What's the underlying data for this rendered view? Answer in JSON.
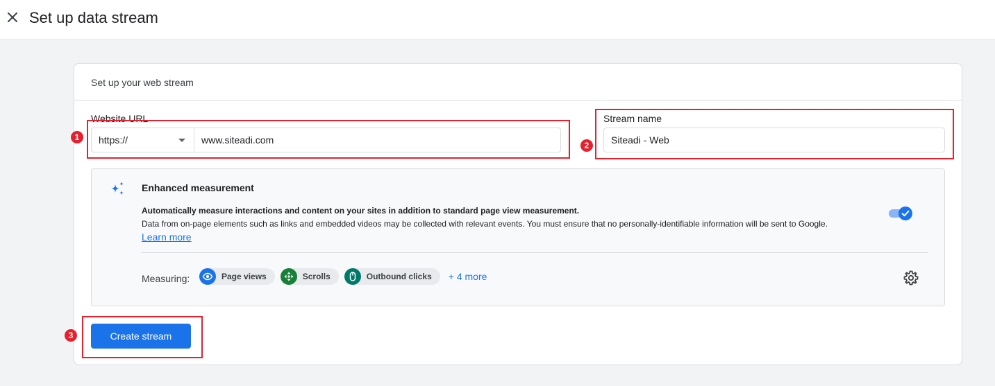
{
  "header": {
    "title": "Set up data stream",
    "close_icon": "close-icon"
  },
  "card": {
    "title": "Set up your web stream",
    "website_url": {
      "label": "Website URL",
      "protocol": "https://",
      "value": "www.siteadi.com"
    },
    "stream_name": {
      "label": "Stream name",
      "value": "Siteadi - Web"
    },
    "enhanced_measurement": {
      "title": "Enhanced measurement",
      "description_bold": "Automatically measure interactions and content on your sites in addition to standard page view measurement.",
      "description": "Data from on-page elements such as links and embedded videos may be collected with relevant events. You must ensure that no personally-identifiable information will be sent to Google.",
      "learn_more": "Learn more",
      "enabled": true,
      "measuring_label": "Measuring:",
      "chips": [
        {
          "label": "Page views",
          "icon": "eye-icon",
          "color": "#1a73e8"
        },
        {
          "label": "Scrolls",
          "icon": "scroll-arrows-icon",
          "color": "#188038"
        },
        {
          "label": "Outbound clicks",
          "icon": "mouse-icon",
          "color": "#00796b"
        }
      ],
      "more": "+ 4 more"
    },
    "create_button": "Create stream"
  },
  "annotations": {
    "badges": [
      "1",
      "2",
      "3"
    ],
    "color": "#e8202e"
  },
  "colors": {
    "accent": "#1a73e8",
    "highlight": "#e8202e"
  }
}
